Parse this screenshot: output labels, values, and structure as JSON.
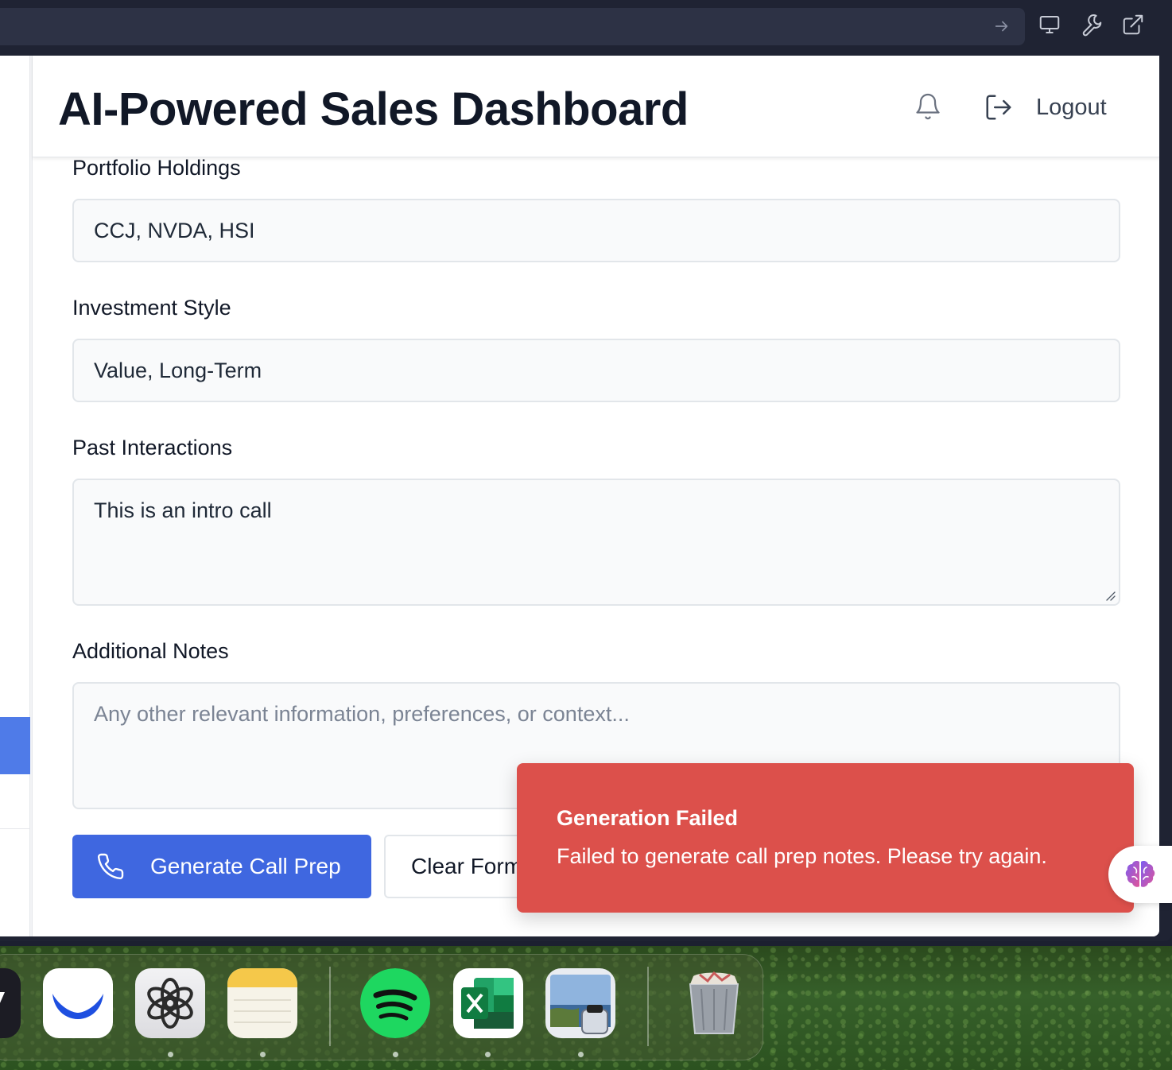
{
  "header": {
    "title": "AI-Powered Sales Dashboard",
    "logout_label": "Logout"
  },
  "form": {
    "portfolio": {
      "label": "Portfolio Holdings",
      "value": "CCJ, NVDA, HSI"
    },
    "style": {
      "label": "Investment Style",
      "value": "Value, Long-Term"
    },
    "interactions": {
      "label": "Past Interactions",
      "value": "This is an intro call"
    },
    "notes": {
      "label": "Additional Notes",
      "value": "",
      "placeholder": "Any other relevant information, preferences, or context..."
    },
    "generate_label": "Generate Call Prep",
    "clear_label": "Clear Form"
  },
  "toast": {
    "title": "Generation Failed",
    "message": "Failed to generate call prep notes. Please try again."
  },
  "colors": {
    "primary": "#3f67e0",
    "toast_error": "#dc504b",
    "sidebar_active": "#4f7be8"
  },
  "dock": {
    "apps": [
      "partial-app-icon",
      "bluesky-icon",
      "chatgpt-icon",
      "notes-icon",
      "spotify-icon",
      "excel-icon",
      "preview-icon",
      "trash-icon"
    ]
  }
}
